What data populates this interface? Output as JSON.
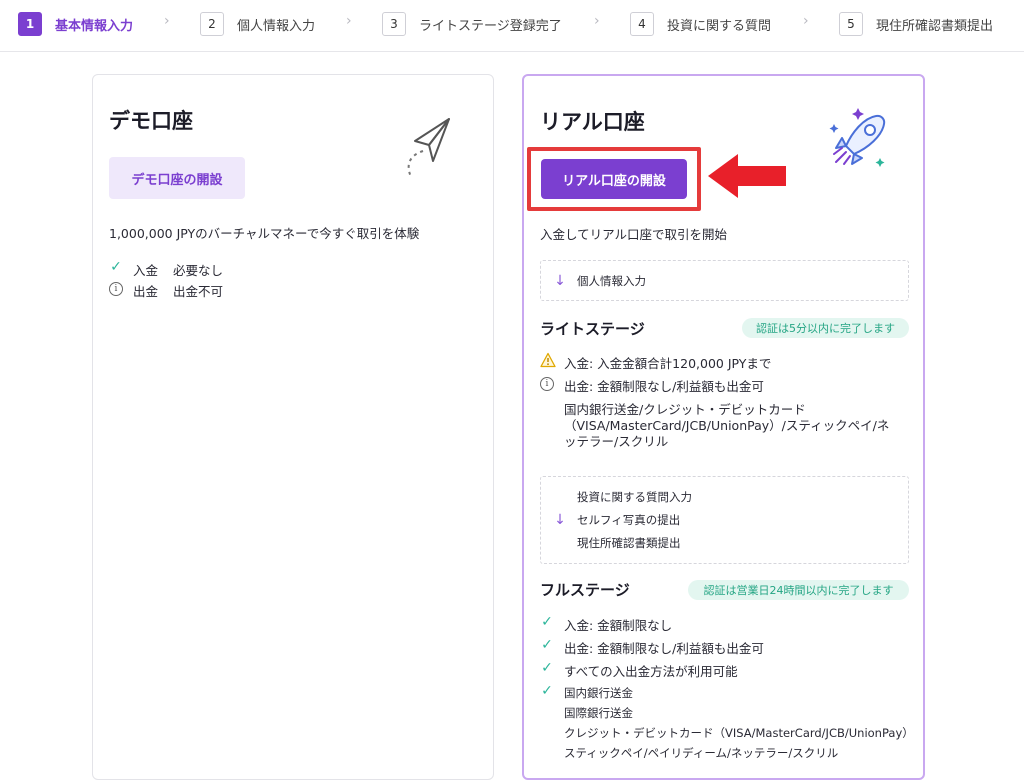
{
  "stepper": {
    "steps": [
      {
        "num": "1",
        "label": "基本情報入力"
      },
      {
        "num": "2",
        "label": "個人情報入力"
      },
      {
        "num": "3",
        "label": "ライトステージ登録完了"
      },
      {
        "num": "4",
        "label": "投資に関する質問"
      },
      {
        "num": "5",
        "label": "現住所確認書類提出"
      }
    ],
    "separator": "›"
  },
  "demo": {
    "title": "デモ口座",
    "button": "デモ口座の開設",
    "description": "1,000,000 JPYのバーチャルマネーで今すぐ取引を体験",
    "rows": [
      {
        "icon": "check-icon",
        "label": "入金",
        "value": "必要なし"
      },
      {
        "icon": "info-icon",
        "label": "出金",
        "value": "出金不可"
      }
    ]
  },
  "real": {
    "title": "リアル口座",
    "button": "リアル口座の開設",
    "description": "入金してリアル口座で取引を開始",
    "step_personal": "個人情報入力",
    "light": {
      "title": "ライトステージ",
      "badge": "認証は5分以内に完了します",
      "deposit": "入金: 入金金額合計120,000 JPYまで",
      "withdraw": "出金: 金額制限なし/利益額も出金可",
      "methods_1": "国内銀行送金/クレジット・デビットカード",
      "methods_2": "（VISA/MasterCard/JCB/UnionPay）/スティックペイ/ネ",
      "methods_3": "ッテラー/スクリル"
    },
    "steps_box": [
      "投資に関する質問入力",
      "セルフィ写真の提出",
      "現住所確認書類提出"
    ],
    "full": {
      "title": "フルステージ",
      "badge": "認証は営業日24時間以内に完了します",
      "items": [
        "入金: 金額制限なし",
        "出金: 金額制限なし/利益額も出金可",
        "すべての入出金方法が利用可能"
      ],
      "methods": [
        "国内銀行送金",
        "国際銀行送金",
        "クレジット・デビットカード（VISA/MasterCard/JCB/UnionPay）",
        "スティックペイ/ペイリディーム/ネッテラー/スクリル"
      ]
    }
  },
  "colors": {
    "accent": "#7b3fd0",
    "highlight": "#e53b3b",
    "success": "#25a584"
  }
}
